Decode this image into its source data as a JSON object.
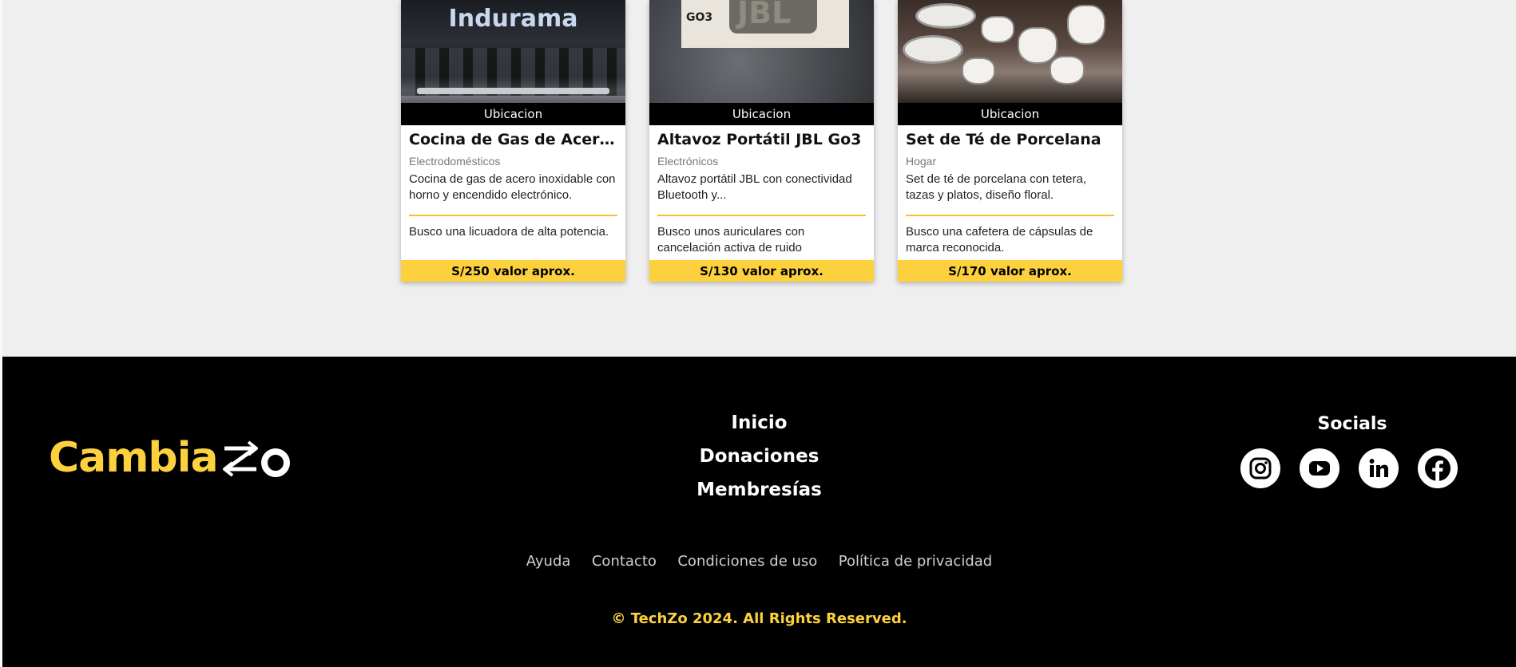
{
  "products": [
    {
      "location": "Ubicacion",
      "title": "Cocina de Gas de Acero Inoxidable",
      "category": "Electrodomésticos",
      "description": "Cocina de gas de acero inoxidable con horno y encendido electrónico.",
      "wish": "Busco una licuadora de alta potencia.",
      "price": "S/250 valor aprox.",
      "image_brand": "Indurama"
    },
    {
      "location": "Ubicacion",
      "title": "Altavoz Portátil JBL Go3",
      "category": "Electrónicos",
      "description": "Altavoz portátil JBL con conectividad Bluetooth y...",
      "wish": "Busco unos auriculares con cancelación activa de ruido",
      "price": "S/130 valor aprox.",
      "image_brand": "JBL",
      "image_model": "GO3"
    },
    {
      "location": "Ubicacion",
      "title": "Set de Té de Porcelana",
      "category": "Hogar",
      "description": "Set de té de porcelana con tetera, tazas y platos, diseño floral.",
      "wish": "Busco una cafetera de cápsulas de marca reconocida.",
      "price": "S/170 valor aprox."
    }
  ],
  "footer": {
    "logo_text": "Cambia",
    "logo_suffix": "o",
    "nav": [
      "Inicio",
      "Donaciones",
      "Membresías"
    ],
    "socials_title": "Socials",
    "socials": [
      "instagram-icon",
      "youtube-icon",
      "linkedin-icon",
      "facebook-icon"
    ],
    "legal_links": [
      "Ayuda",
      "Contacto",
      "Condiciones de uso",
      "Política de privacidad"
    ],
    "copyright": "© TechZo 2024. All Rights Reserved."
  },
  "colors": {
    "accent": "#fdd13d",
    "footer_bg": "#000000",
    "page_bg": "#efefef"
  }
}
